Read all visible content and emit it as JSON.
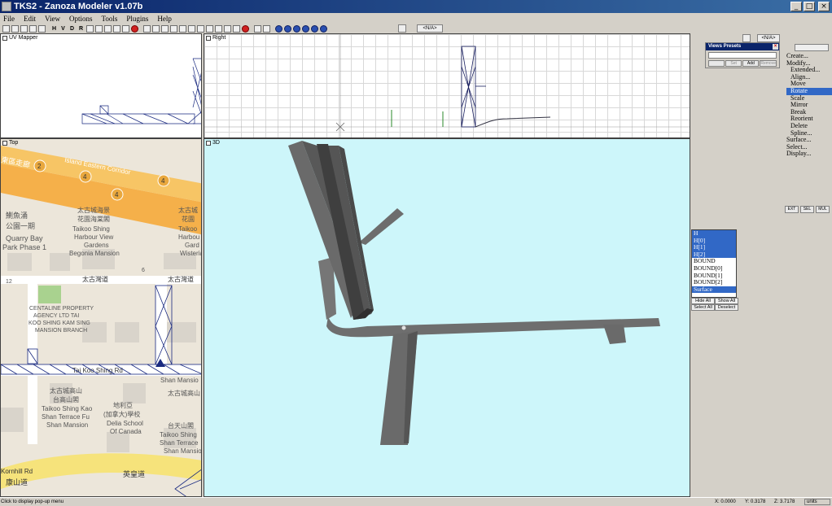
{
  "window": {
    "title": "TKS2 - Zanoza Modeler v1.07b",
    "minimize": "_",
    "maximize": "□",
    "close": "×"
  },
  "menu": [
    "File",
    "Edit",
    "View",
    "Options",
    "Tools",
    "Plugins",
    "Help"
  ],
  "toolbar": {
    "letters": [
      "H",
      "V",
      "D",
      "R"
    ],
    "na_center": "<N/A>",
    "na_right": "<N/A>"
  },
  "viewports": {
    "uv": "UV Mapper",
    "right": "Right",
    "top": "Top",
    "three_d": "3D"
  },
  "map_labels": {
    "corridor_cn": "東區走廊",
    "corridor_en": "Island Eastern Corridor",
    "route_num": "4",
    "route_num_2": "2",
    "quarry_cn1": "鰂魚涌",
    "quarry_cn2": "公園一期",
    "quarry_en1": "Quarry Bay",
    "quarry_en2": "Park Phase 1",
    "hv_cn1": "太古城海景",
    "hv_cn2": "花園海棠閣",
    "hv_en1": "Taikoo Shing",
    "hv_en2": "Harbour View",
    "hv_en3": "Gardens",
    "hv_en4": "Begonia Mansion",
    "hv_right_cn1": "太古城",
    "hv_right_cn2": "花園",
    "hv_right_en1": "Taikoo",
    "hv_right_en2": "Harbou",
    "hv_right_en3": "Gard",
    "hv_right_en4": "Wisteria",
    "taikoo_wan_rd": "太古灣道",
    "centaline_1": "CENTALINE PROPERTY",
    "centaline_2": "AGENCY LTD TAI",
    "centaline_3": "KOO SHING KAM SING",
    "centaline_4": "MANSION BRANCH",
    "shing_rd": "Tai Koo Shing Rd",
    "terrace_cn1": "太古城高山",
    "terrace_cn2": "台高山閣",
    "terrace_en1": "Taikoo Shing Kao",
    "terrace_en2": "Shan Terrace Fu",
    "terrace_en3": "Shan Mansion",
    "dc_cn1": "地利亞",
    "dc_cn2": "(加拿大)學校",
    "dc_en1": "Delia School",
    "dc_en2": "Of Canada",
    "right_cn1": "太古城高山",
    "right_cn2": "台天山閣",
    "right_en1": "Taikoo Shing",
    "right_en2": "Shan Terrace",
    "right_en3": "Shan Mansion",
    "shan_mansio": "Shan Mansio",
    "kornhill_en": "Kornhill Rd",
    "kornhill_cn": "康山道",
    "kings_cn": "英皇道",
    "grid_12": "12",
    "grid_6": "6"
  },
  "views_presets": {
    "title": "Views Presets",
    "set": "Set",
    "add": "Add",
    "remove": "Remove"
  },
  "modify_menu": [
    {
      "label": "Create...",
      "sub": false,
      "selected": false
    },
    {
      "label": "Modify...",
      "sub": false,
      "selected": false
    },
    {
      "label": "Extended...",
      "sub": true,
      "selected": false
    },
    {
      "label": "Align...",
      "sub": true,
      "selected": false
    },
    {
      "label": "Move",
      "sub": true,
      "selected": false
    },
    {
      "label": "Rotate",
      "sub": true,
      "selected": true
    },
    {
      "label": "Scale",
      "sub": true,
      "selected": false
    },
    {
      "label": "Mirror",
      "sub": true,
      "selected": false
    },
    {
      "label": "Break",
      "sub": true,
      "selected": false
    },
    {
      "label": "Reorient",
      "sub": true,
      "selected": false
    },
    {
      "label": "Delete",
      "sub": true,
      "selected": false
    },
    {
      "label": "Spline...",
      "sub": true,
      "selected": false
    },
    {
      "label": "Surface...",
      "sub": false,
      "selected": false
    },
    {
      "label": "Select...",
      "sub": false,
      "selected": false
    },
    {
      "label": "Display...",
      "sub": false,
      "selected": false
    }
  ],
  "mode_buttons": [
    "EXT",
    "SEL",
    "MUL"
  ],
  "layers": [
    {
      "label": "H",
      "selected": true
    },
    {
      "label": "H[0]",
      "selected": true
    },
    {
      "label": "H[1]",
      "selected": true
    },
    {
      "label": "H[2]",
      "selected": true
    },
    {
      "label": "BOUND",
      "selected": false
    },
    {
      "label": "BOUND[0]",
      "selected": false
    },
    {
      "label": "BOUND[1]",
      "selected": false
    },
    {
      "label": "BOUND[2]",
      "selected": false
    },
    {
      "label": "Surface",
      "selected": true
    }
  ],
  "layer_buttons": [
    "Hide All",
    "Show All",
    "Select All",
    "Deselect"
  ],
  "status": {
    "message": "Click to display pop-up menu",
    "x": "X: 0.0000",
    "y": "Y: 0.3178",
    "z": "Z: 3.7178",
    "units": "units"
  },
  "colors": {
    "titlebar": "#0a246a",
    "viewport_3d_bg": "#cdf6fa",
    "selection": "#3168c6",
    "road_gray": "#6d6d6d"
  }
}
